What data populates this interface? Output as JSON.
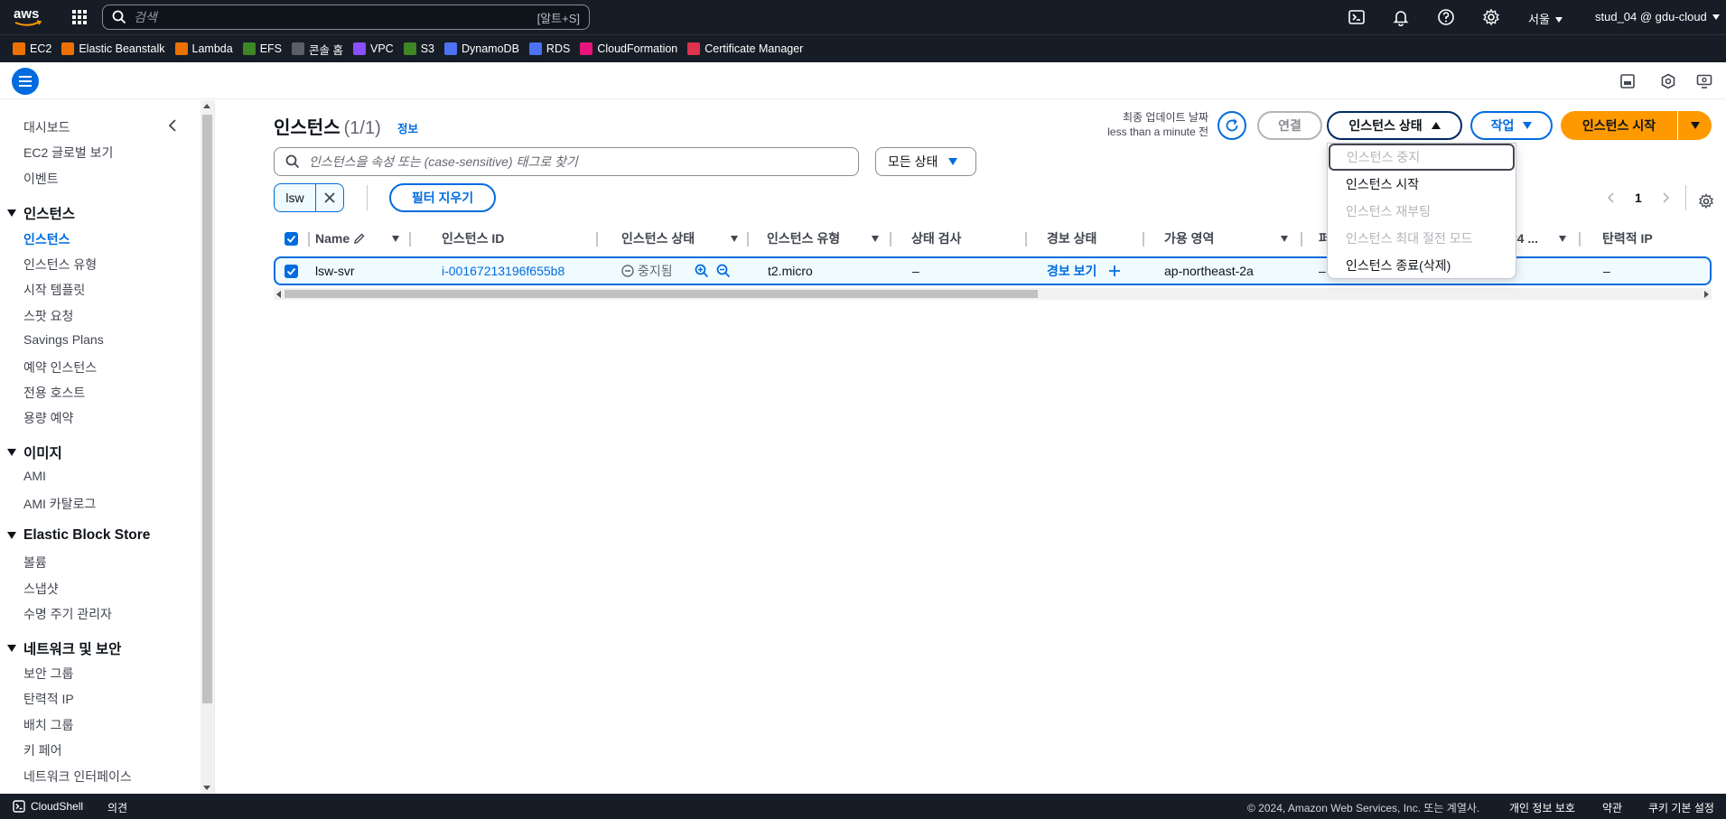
{
  "topnav": {
    "search_placeholder": "검색",
    "search_shortcut": "[알트+S]",
    "region": "서울",
    "account": "stud_04 @ gdu-cloud"
  },
  "favorites": [
    {
      "label": "EC2",
      "color": "#ed7100"
    },
    {
      "label": "Elastic Beanstalk",
      "color": "#ed7100"
    },
    {
      "label": "Lambda",
      "color": "#ed7100"
    },
    {
      "label": "EFS",
      "color": "#3f8624"
    },
    {
      "label": "콘솔 홈",
      "color": "#5a5f66"
    },
    {
      "label": "VPC",
      "color": "#8c4fff"
    },
    {
      "label": "S3",
      "color": "#3f8624"
    },
    {
      "label": "DynamoDB",
      "color": "#4d72f3"
    },
    {
      "label": "RDS",
      "color": "#4d72f3"
    },
    {
      "label": "CloudFormation",
      "color": "#e7157b"
    },
    {
      "label": "Certificate Manager",
      "color": "#dd344c"
    }
  ],
  "sidebar": {
    "top_items": [
      "대시보드",
      "EC2 글로벌 보기",
      "이벤트"
    ],
    "sections": [
      {
        "title": "인스턴스",
        "items": [
          "인스턴스",
          "인스턴스 유형",
          "시작 템플릿",
          "스팟 요청",
          "Savings Plans",
          "예약 인스턴스",
          "전용 호스트",
          "용량 예약"
        ]
      },
      {
        "title": "이미지",
        "items": [
          "AMI",
          "AMI 카탈로그"
        ]
      },
      {
        "title": "Elastic Block Store",
        "items": [
          "볼륨",
          "스냅샷",
          "수명 주기 관리자"
        ]
      },
      {
        "title": "네트워크 및 보안",
        "items": [
          "보안 그룹",
          "탄력적 IP",
          "배치 그룹",
          "키 페어",
          "네트워크 인터페이스"
        ]
      }
    ]
  },
  "page": {
    "title": "인스턴스",
    "count": "(1/1)",
    "info": "정보",
    "last_updated_label": "최종 업데이트 날짜",
    "last_updated_value": "less than a minute 전",
    "connect_btn": "연결",
    "state_btn": "인스턴스 상태",
    "actions_btn": "작업",
    "launch_btn": "인스턴스 시작",
    "filter_placeholder": "인스턴스을 속성 또는 (case-sensitive) 태그로 찾기",
    "state_filter": "모든 상태",
    "token": "lsw",
    "clear_filters": "필터 지우기",
    "page_number": "1"
  },
  "table": {
    "headers": [
      "Name",
      "인스턴스 ID",
      "인스턴스 상태",
      "인스턴스 유형",
      "상태 검사",
      "경보 상태",
      "가용 영역",
      "퍼",
      "블릭 IPv4 ...",
      "탄력적 IP"
    ],
    "row": {
      "name": "lsw-svr",
      "instance_id": "i-00167213196f655b8",
      "state": "중지됨",
      "type": "t2.micro",
      "status_check": "–",
      "alarm": "경보 보기",
      "az": "ap-northeast-2a",
      "public_dns": "–",
      "elastic_ip": "–"
    }
  },
  "state_menu": [
    {
      "label": "인스턴스 중지",
      "enabled": false
    },
    {
      "label": "인스턴스 시작",
      "enabled": true
    },
    {
      "label": "인스턴스 재부팅",
      "enabled": false
    },
    {
      "label": "인스턴스 최대 절전 모드",
      "enabled": false
    },
    {
      "label": "인스턴스 종료(삭제)",
      "enabled": true
    }
  ],
  "footer": {
    "cloudshell": "CloudShell",
    "feedback": "의견",
    "copyright": "© 2024, Amazon Web Services, Inc. 또는 계열사.",
    "privacy": "개인 정보 보호",
    "terms": "약관",
    "cookies": "쿠키 기본 설정"
  }
}
